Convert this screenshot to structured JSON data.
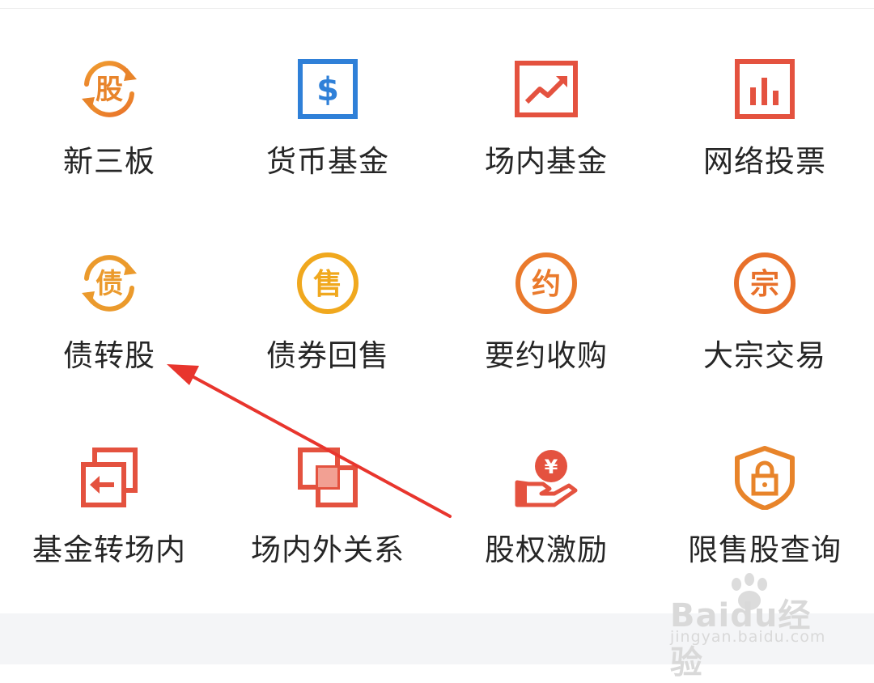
{
  "grid": {
    "items": [
      {
        "label": "新三板",
        "icon": "rotating-stock-icon",
        "glyph": "股"
      },
      {
        "label": "货币基金",
        "icon": "dollar-box-icon",
        "glyph": "$"
      },
      {
        "label": "场内基金",
        "icon": "trend-chart-icon"
      },
      {
        "label": "网络投票",
        "icon": "bar-chart-icon"
      },
      {
        "label": "债转股",
        "icon": "rotating-bond-icon",
        "glyph": "债"
      },
      {
        "label": "债券回售",
        "icon": "sell-circle-icon",
        "glyph": "售"
      },
      {
        "label": "要约收购",
        "icon": "offer-circle-icon",
        "glyph": "约"
      },
      {
        "label": "大宗交易",
        "icon": "block-trade-circle-icon",
        "glyph": "宗"
      },
      {
        "label": "基金转场内",
        "icon": "transfer-in-icon"
      },
      {
        "label": "场内外关系",
        "icon": "overlap-squares-icon"
      },
      {
        "label": "股权激励",
        "icon": "yen-hand-icon",
        "glyph": "¥"
      },
      {
        "label": "限售股查询",
        "icon": "lock-shield-icon"
      }
    ]
  },
  "watermark": {
    "brand": "Bai",
    "brand2": "du",
    "product": "经验",
    "url": "jingyan.baidu.com"
  },
  "colors": {
    "orange": "#e8842a",
    "red": "#e4523f",
    "blue": "#2f80d8",
    "text": "#262626",
    "arrow": "#e8352d"
  }
}
